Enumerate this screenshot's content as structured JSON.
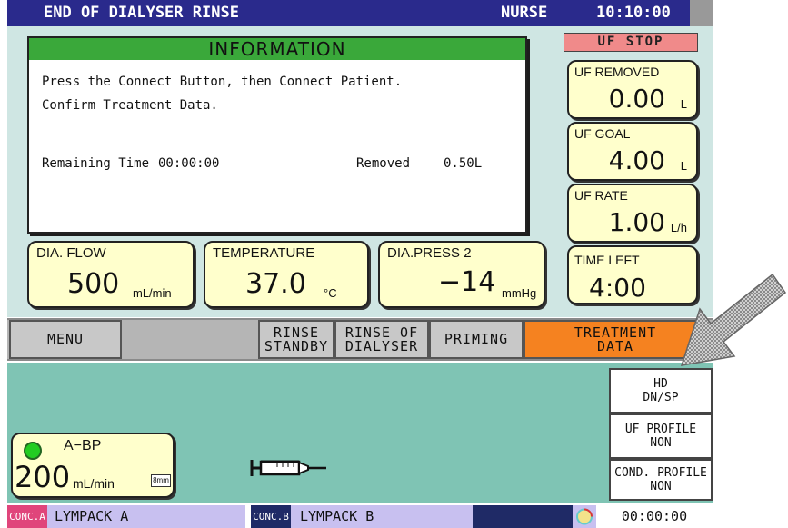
{
  "titlebar": {
    "screen_title": "END OF DIALYSER RINSE",
    "user": "NURSE",
    "clock": "10:10:00"
  },
  "information": {
    "header": "INFORMATION",
    "line1": "Press the Connect Button, then Connect Patient.",
    "line2": "Confirm Treatment Data.",
    "remaining_label": "Remaining Time",
    "remaining_value": "00:00:00",
    "removed_label": "Removed",
    "removed_value": "0.50L"
  },
  "uf": {
    "status": "UF STOP",
    "removed": {
      "label": "UF REMOVED",
      "value": "0.00",
      "unit": "L"
    },
    "goal": {
      "label": "UF GOAL",
      "value": "4.00",
      "unit": "L"
    },
    "rate": {
      "label": "UF RATE",
      "value": "1.00",
      "unit": "L/h"
    },
    "time_left": {
      "label": "TIME LEFT",
      "value": "4:00"
    }
  },
  "measurements": {
    "dia_flow": {
      "label": "DIA. FLOW",
      "value": "500",
      "unit": "mL/min"
    },
    "temperature": {
      "label": "TEMPERATURE",
      "value": "37.0",
      "unit": "°C"
    },
    "dia_press": {
      "label": "DIA.PRESS 2",
      "value": "−14",
      "unit": "mmHg"
    }
  },
  "buttons": {
    "menu": "MENU",
    "rinse_standby": "RINSE\nSTANDBY",
    "rinse_dialyser": "RINSE OF\nDIALYSER",
    "priming": "PRIMING",
    "treatment_data": "TREATMENT\nDATA"
  },
  "lower": {
    "mode": "HD\nDN/SP",
    "uf_profile": "UF PROFILE\nNON",
    "cond_profile": "COND. PROFILE\nNON",
    "abp": {
      "label": "A−BP",
      "value": "200",
      "unit": "mL/min",
      "tag": "8mm"
    }
  },
  "statusbar": {
    "conc_a_tag": "CONC.A",
    "conc_a": "LYMPACK A",
    "conc_b_tag": "CONC.B",
    "conc_b": "LYMPACK B",
    "timer": "00:00:00"
  },
  "colors": {
    "title_bar": "#2a2a8c",
    "info_header": "#3aa83a",
    "uf_stop": "#f08a8a",
    "treatment_button": "#f58220",
    "upper_panel": "#cfe6e3",
    "lower_panel": "#7fc4b4",
    "value_box": "#ffffcc"
  },
  "icons": [
    "pointer-arrow-icon",
    "syringe-icon",
    "status-led-icon"
  ]
}
